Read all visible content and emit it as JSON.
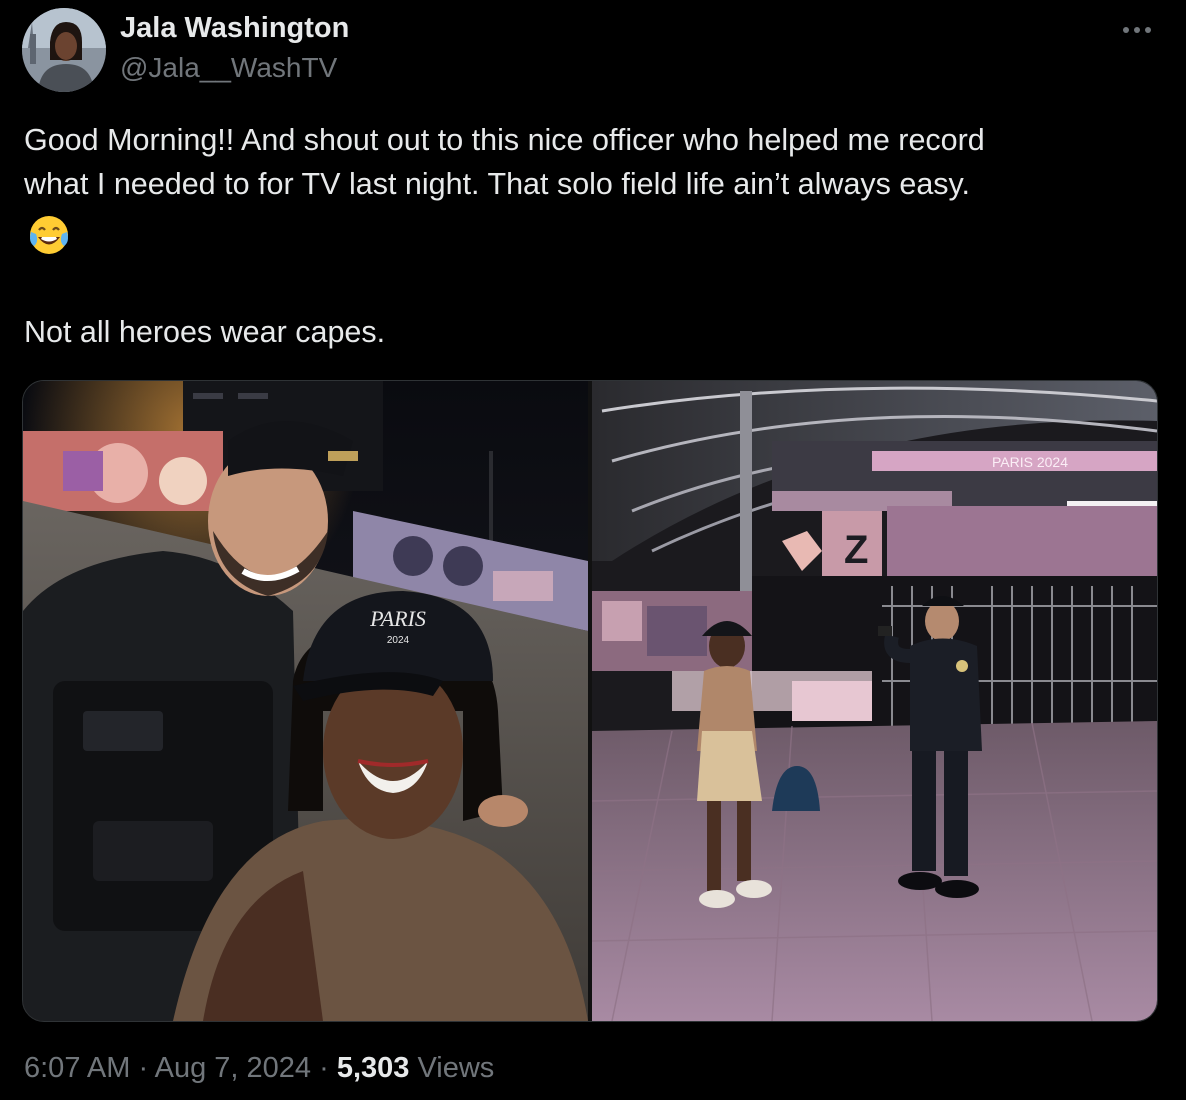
{
  "author": {
    "display_name": "Jala Washington",
    "handle": "@Jala__WashTV",
    "avatar_icon": "profile-photo"
  },
  "tweet": {
    "line1": "Good Morning!! And shout out to this nice officer who helped me record",
    "line2": "what I needed to for TV last night. That solo field life ain’t always easy.",
    "emoji": "😂",
    "line3": "Not all heroes wear capes."
  },
  "media": {
    "photo_left_text": {
      "cap_brand": "PARIS",
      "cap_year": "2024"
    },
    "photo_right_text": {
      "banner": "PARIS 2024",
      "gate_letter": "Z"
    }
  },
  "meta": {
    "time": "6:07 AM",
    "separator": "·",
    "date": "Aug 7, 2024",
    "views_count": "5,303",
    "views_label": "Views"
  },
  "more_icon": "more-horizontal-icon",
  "colors": {
    "background": "#000000",
    "text_primary": "#e7e9ea",
    "text_secondary": "#71767b",
    "border": "#2f3336"
  }
}
